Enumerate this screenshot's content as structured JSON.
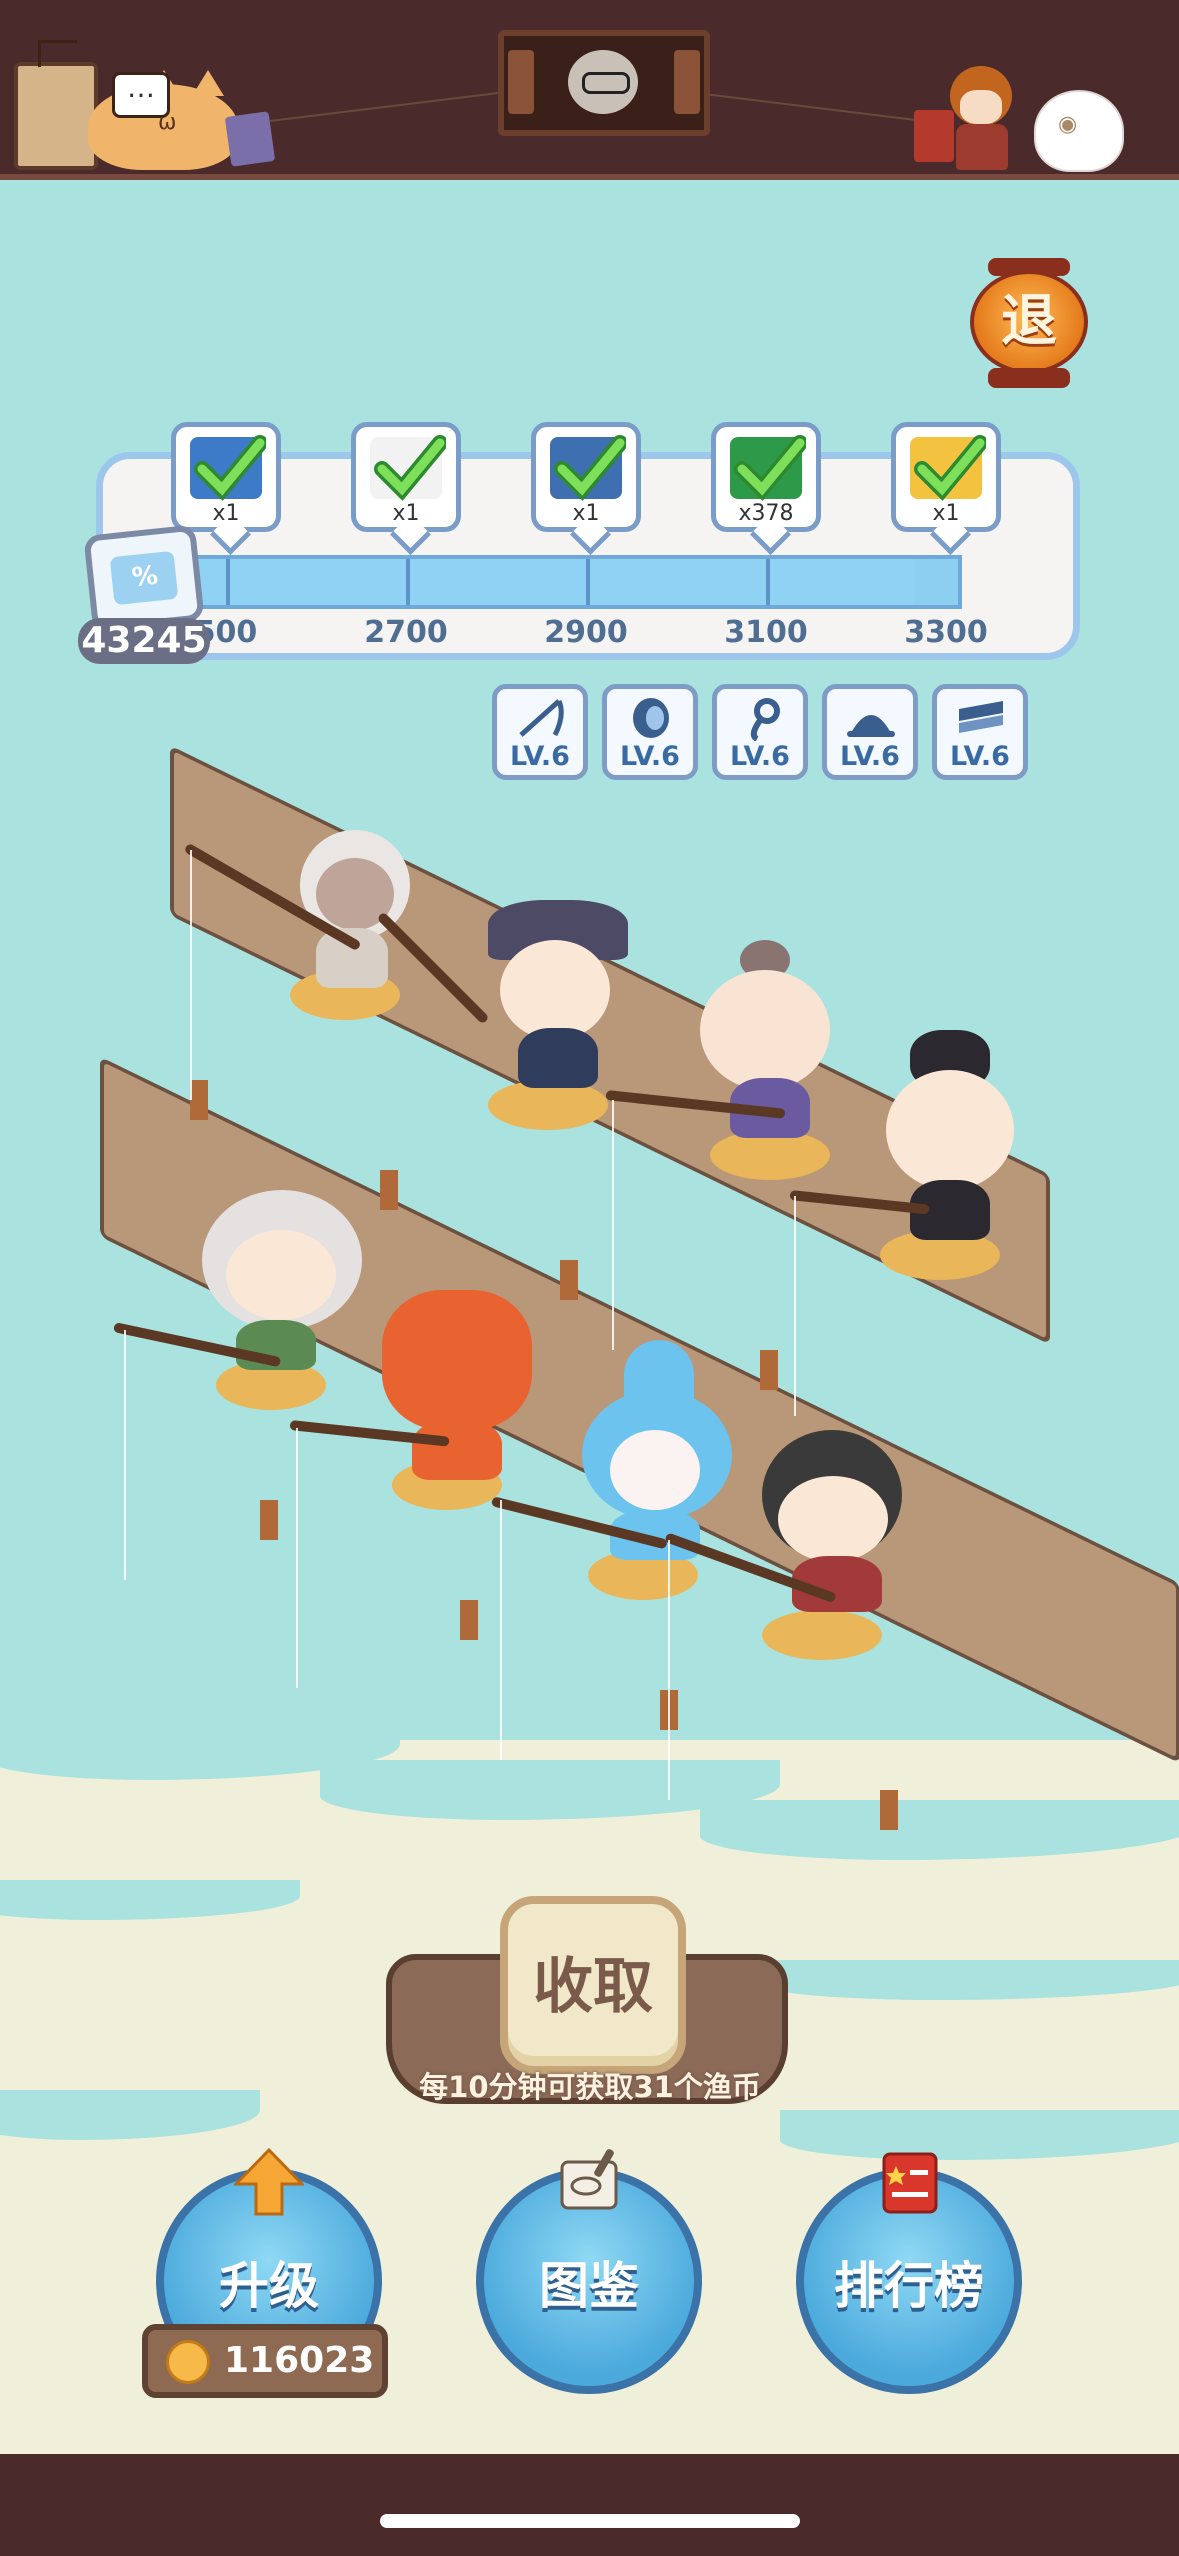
{
  "exit_label": "退",
  "score": "43245",
  "milestones": [
    {
      "label": "2500",
      "display": "500",
      "count": "x1",
      "item": "poster",
      "color": "#3d7ac7"
    },
    {
      "label": "2700",
      "display": "2700",
      "count": "x1",
      "item": "card",
      "color": "#f2f2f2"
    },
    {
      "label": "2900",
      "display": "2900",
      "count": "x1",
      "item": "poster",
      "color": "#3e6fb0"
    },
    {
      "label": "3100",
      "display": "3100",
      "count": "x378",
      "item": "pearl",
      "color": "#2d9a4a"
    },
    {
      "label": "3300",
      "display": "3300",
      "count": "x1",
      "item": "ticket",
      "color": "#f3c23f"
    }
  ],
  "progress": 0.95,
  "levels": [
    {
      "label": "LV.6",
      "icon": "fishing-rod-icon"
    },
    {
      "label": "LV.6",
      "icon": "reel-icon"
    },
    {
      "label": "LV.6",
      "icon": "hook-icon"
    },
    {
      "label": "LV.6",
      "icon": "float-hat-icon"
    },
    {
      "label": "LV.6",
      "icon": "dock-icon"
    }
  ],
  "collect_label": "收取",
  "collect_hint": "每10分钟可获取31个渔币",
  "upgrade_label": "升级",
  "coins": "116023",
  "guide_label": "图鉴",
  "rank_label": "排行榜",
  "colors": {
    "accent": "#4ba9dc",
    "water": "#a9e2df",
    "topbar": "#4a2a2a"
  }
}
